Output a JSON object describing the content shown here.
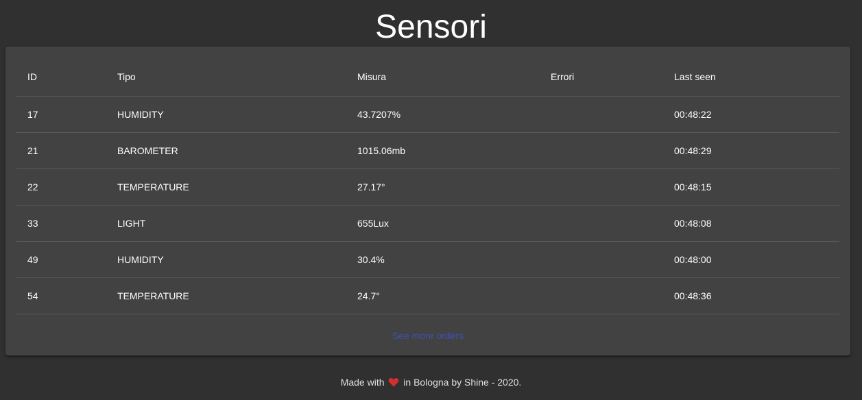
{
  "page": {
    "title": "Sensori"
  },
  "table": {
    "columns": [
      "ID",
      "Tipo",
      "Misura",
      "Errori",
      "Last seen"
    ],
    "rows": [
      {
        "id": "17",
        "tipo": "HUMIDITY",
        "misura": "43.7207%",
        "errori": "",
        "last_seen": "00:48:22"
      },
      {
        "id": "21",
        "tipo": "BAROMETER",
        "misura": "1015.06mb",
        "errori": "",
        "last_seen": "00:48:29"
      },
      {
        "id": "22",
        "tipo": "TEMPERATURE",
        "misura": "27.17°",
        "errori": "",
        "last_seen": "00:48:15"
      },
      {
        "id": "33",
        "tipo": "LIGHT",
        "misura": "655Lux",
        "errori": "",
        "last_seen": "00:48:08"
      },
      {
        "id": "49",
        "tipo": "HUMIDITY",
        "misura": "30.4%",
        "errori": "",
        "last_seen": "00:48:00"
      },
      {
        "id": "54",
        "tipo": "TEMPERATURE",
        "misura": "24.7°",
        "errori": "",
        "last_seen": "00:48:36"
      }
    ]
  },
  "more_link": {
    "label": "See more orders"
  },
  "footer": {
    "prefix": "Made with",
    "suffix": "in Bologna by Shine - 2020.",
    "heart_icon": "heart-icon"
  },
  "colors": {
    "background": "#303030",
    "card": "#424242",
    "link": "#3f51b5",
    "heart": "#d32f2f"
  }
}
